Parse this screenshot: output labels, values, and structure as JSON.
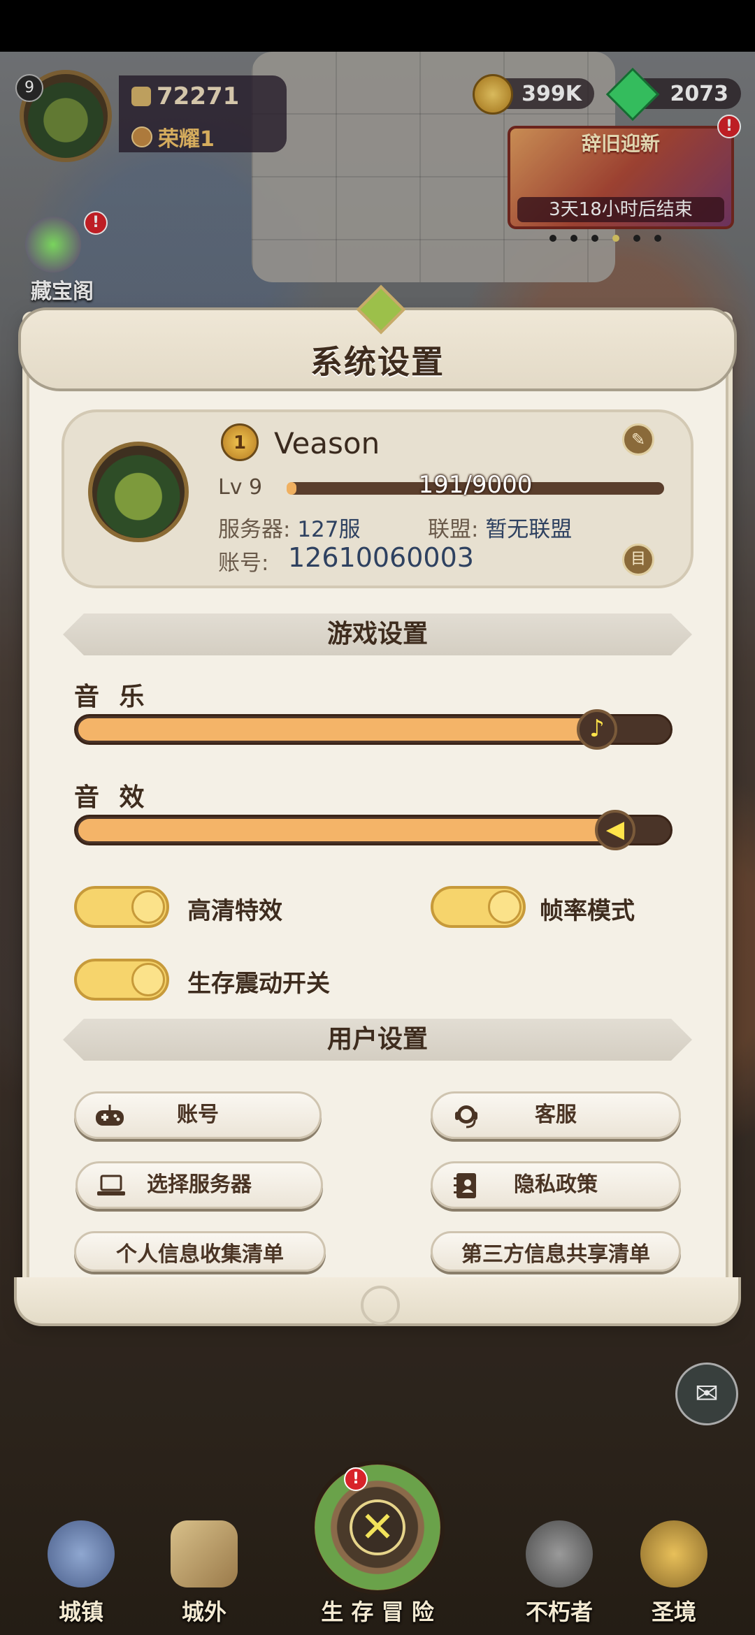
{
  "hud": {
    "level": "9",
    "power": "72271",
    "honor": "荣耀1",
    "gold": "399K",
    "gems": "2073",
    "event_title": "辞旧迎新",
    "event_timer": "3天18小时后结束",
    "treasure_label": "藏宝阁",
    "alert": "!"
  },
  "modal": {
    "title": "系统设置",
    "profile": {
      "rank": "1",
      "name": "Veason",
      "level": "Lv 9",
      "exp_text": "191/9000",
      "exp_fraction": 0.021,
      "server_label": "服务器:",
      "server_value": "127服",
      "alliance_label": "联盟:",
      "alliance_value": "暂无联盟",
      "account_label": "账号:",
      "account_value": "12610060003"
    },
    "game_settings": {
      "header": "游戏设置",
      "music_label": "音 乐",
      "music_level": 0.88,
      "sfx_label": "音 效",
      "sfx_level": 0.91,
      "toggles": [
        {
          "label": "高清特效",
          "on": true
        },
        {
          "label": "帧率模式",
          "on": true
        },
        {
          "label": "生存震动开关",
          "on": true
        }
      ]
    },
    "user_settings": {
      "header": "用户设置",
      "buttons": {
        "account": "账号",
        "support": "客服",
        "select_server": "选择服务器",
        "privacy": "隐私政策",
        "personal_info": "个人信息收集清单",
        "third_party": "第三方信息共享清单"
      }
    }
  },
  "nav": {
    "town": "城镇",
    "outside": "城外",
    "adventure": "生 存 冒 险",
    "immortal": "不朽者",
    "sanctuary": "圣境"
  },
  "colors": {
    "slider_fill": "#f4b468",
    "toggle_on": "#f6d46c",
    "title_text": "#3e2c1e"
  }
}
